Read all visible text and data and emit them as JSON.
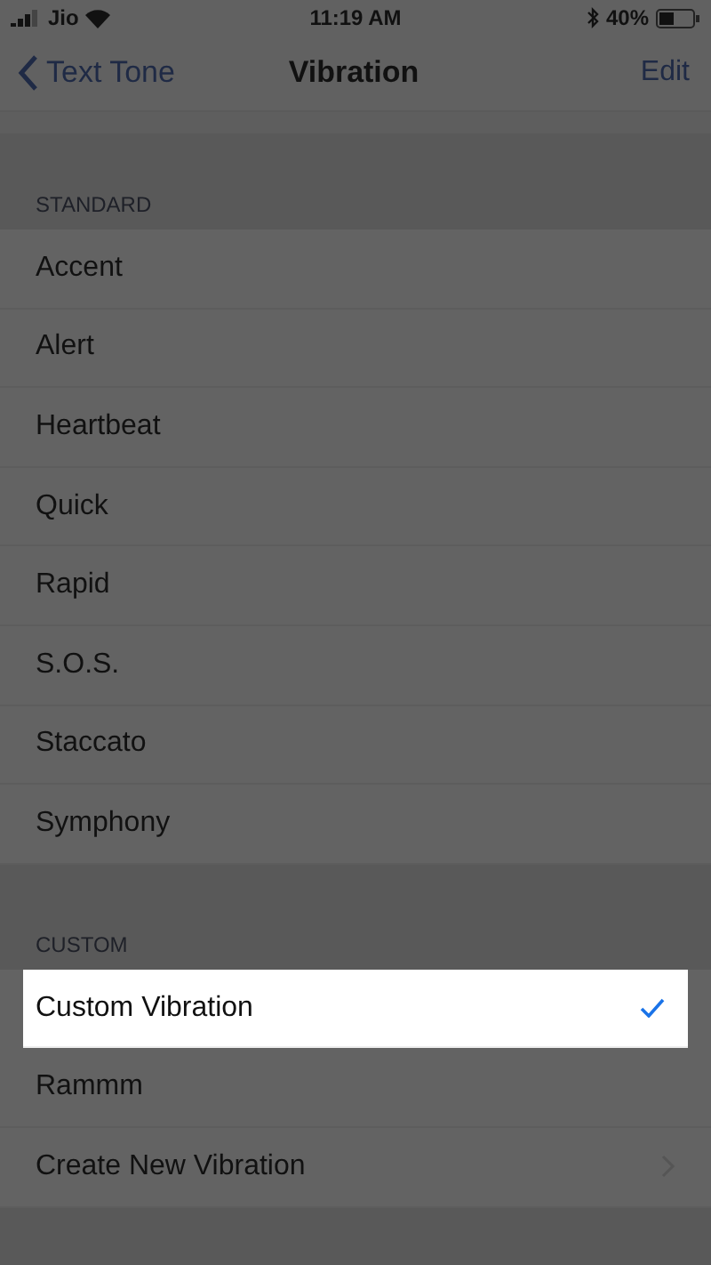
{
  "status_bar": {
    "carrier": "Jio",
    "time": "11:19 AM",
    "battery": "40%"
  },
  "nav": {
    "back": "Text Tone",
    "title": "Vibration",
    "action": "Edit"
  },
  "sections": [
    {
      "header": "STANDARD",
      "items": [
        {
          "label": "Accent",
          "kind": "option",
          "selected": false
        },
        {
          "label": "Alert",
          "kind": "option",
          "selected": false
        },
        {
          "label": "Heartbeat",
          "kind": "option",
          "selected": false
        },
        {
          "label": "Quick",
          "kind": "option",
          "selected": false
        },
        {
          "label": "Rapid",
          "kind": "option",
          "selected": false
        },
        {
          "label": "S.O.S.",
          "kind": "option",
          "selected": false
        },
        {
          "label": "Staccato",
          "kind": "option",
          "selected": false
        },
        {
          "label": "Symphony",
          "kind": "option",
          "selected": false
        }
      ]
    },
    {
      "header": "CUSTOM",
      "items": [
        {
          "label": "Custom Vibration",
          "kind": "option",
          "selected": true
        },
        {
          "label": "Rammm",
          "kind": "option",
          "selected": false
        },
        {
          "label": "Create New Vibration",
          "kind": "disclosure",
          "selected": false
        }
      ]
    }
  ]
}
